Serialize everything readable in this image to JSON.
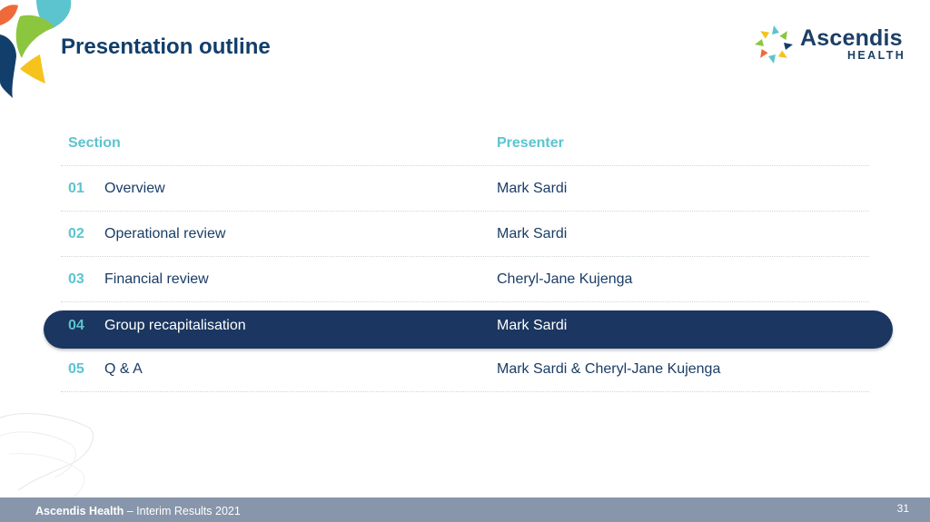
{
  "slide": {
    "title": "Presentation outline",
    "page_number": "31"
  },
  "logo": {
    "name": "Ascendis",
    "sub": "HEALTH"
  },
  "table": {
    "headers": {
      "section": "Section",
      "presenter": "Presenter"
    },
    "rows": [
      {
        "num": "01",
        "section": "Overview",
        "presenter": "Mark Sardi"
      },
      {
        "num": "02",
        "section": "Operational review",
        "presenter": "Mark Sardi"
      },
      {
        "num": "03",
        "section": "Financial review",
        "presenter": "Cheryl-Jane Kujenga"
      },
      {
        "num": "04",
        "section": "Group recapitalisation",
        "presenter": "Mark Sardi"
      },
      {
        "num": "05",
        "section": "Q & A",
        "presenter": "Mark Sardi & Cheryl-Jane Kujenga"
      }
    ],
    "highlighted_row": "04"
  },
  "footer": {
    "company": "Ascendis Health",
    "separator": " – ",
    "subtitle": "Interim Results 2021"
  },
  "colors": {
    "title": "#123e6b",
    "accent_teal": "#5cc4cf",
    "highlight_bar": "#1b3660",
    "footer_bar": "#8796ab"
  }
}
